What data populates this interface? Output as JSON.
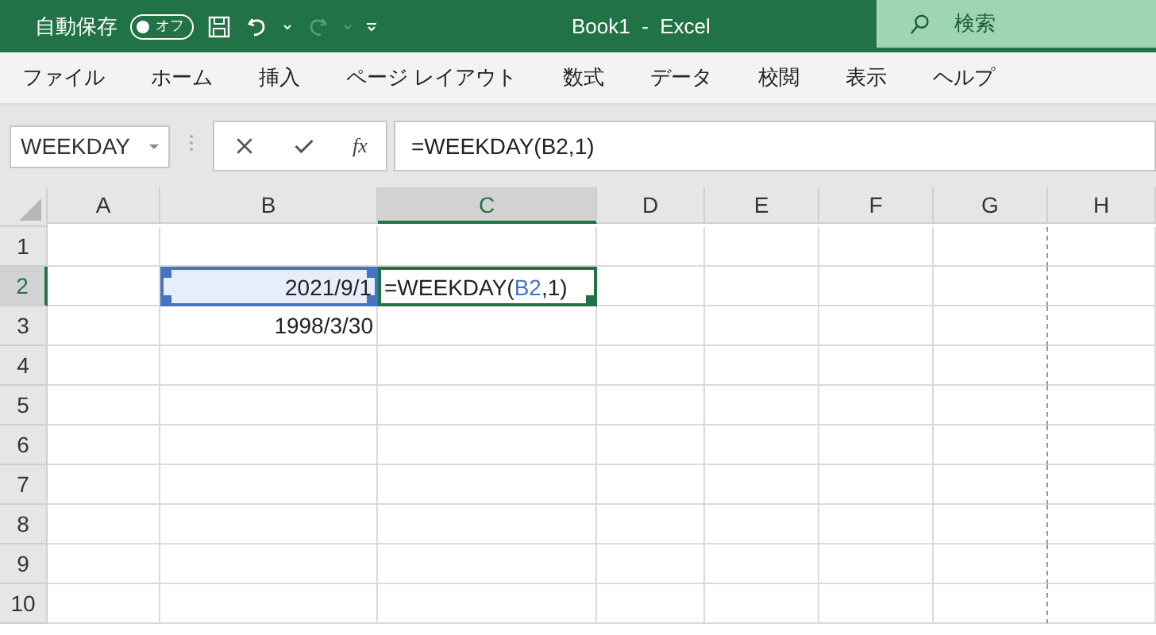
{
  "title_bar": {
    "autosave_label": "自動保存",
    "autosave": {
      "on": false,
      "label": "オフ"
    },
    "redo_disabled": true,
    "title": "Book1  -  Excel",
    "search": {
      "placeholder": "検索"
    }
  },
  "menu": [
    "ファイル",
    "ホーム",
    "挿入",
    "ページ レイアウト",
    "数式",
    "データ",
    "校閲",
    "表示",
    "ヘルプ"
  ],
  "formula_bar": {
    "name_box": "WEEKDAY",
    "fx": "fx",
    "formula": "=WEEKDAY(B2,1)"
  },
  "columns": [
    {
      "label": "A",
      "selected": false,
      "page_break": false
    },
    {
      "label": "B",
      "selected": false,
      "page_break": false
    },
    {
      "label": "C",
      "selected": true,
      "page_break": false
    },
    {
      "label": "D",
      "selected": false,
      "page_break": false
    },
    {
      "label": "E",
      "selected": false,
      "page_break": false
    },
    {
      "label": "F",
      "selected": false,
      "page_break": false
    },
    {
      "label": "G",
      "selected": false,
      "page_break": true
    },
    {
      "label": "H",
      "selected": false,
      "page_break": false
    }
  ],
  "rows": [
    {
      "label": "1",
      "selected": false
    },
    {
      "label": "2",
      "selected": true,
      "cells": [
        {},
        {
          "value": "2021/9/1",
          "referenced": true
        },
        {
          "active": true,
          "parts": [
            {
              "text": "=WEEKDAY(",
              "color": "#222222"
            },
            {
              "text": "B2",
              "color": "#4472c4"
            },
            {
              "text": ",1)",
              "color": "#222222"
            }
          ]
        },
        {},
        {},
        {},
        {},
        {}
      ]
    },
    {
      "label": "3",
      "selected": false,
      "cells": [
        {},
        {
          "value": "1998/3/30"
        },
        {},
        {},
        {},
        {},
        {},
        {}
      ]
    },
    {
      "label": "4",
      "selected": false
    },
    {
      "label": "5",
      "selected": false
    },
    {
      "label": "6",
      "selected": false
    },
    {
      "label": "7",
      "selected": false
    },
    {
      "label": "8",
      "selected": false
    },
    {
      "label": "9",
      "selected": false
    },
    {
      "label": "10",
      "selected": false
    }
  ]
}
